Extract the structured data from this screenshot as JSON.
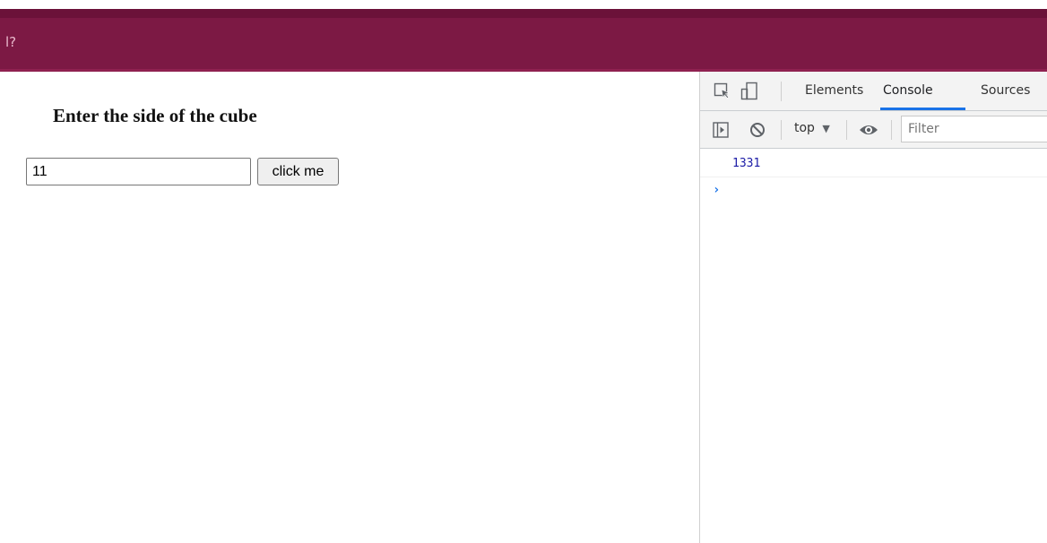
{
  "banner": {
    "text": "l?"
  },
  "page": {
    "heading": "Enter the side of the cube",
    "side_input_value": "11",
    "button_label": "click me"
  },
  "devtools": {
    "tabs": [
      "Elements",
      "Console",
      "Sources"
    ],
    "active_tab": "Console",
    "context_label": "top",
    "filter_placeholder": "Filter",
    "console_output": [
      "1331"
    ],
    "prompt_symbol": "›"
  },
  "colors": {
    "banner": "#7c1944",
    "accent_blue": "#1a73e8",
    "log_value": "#1a1aa6"
  }
}
